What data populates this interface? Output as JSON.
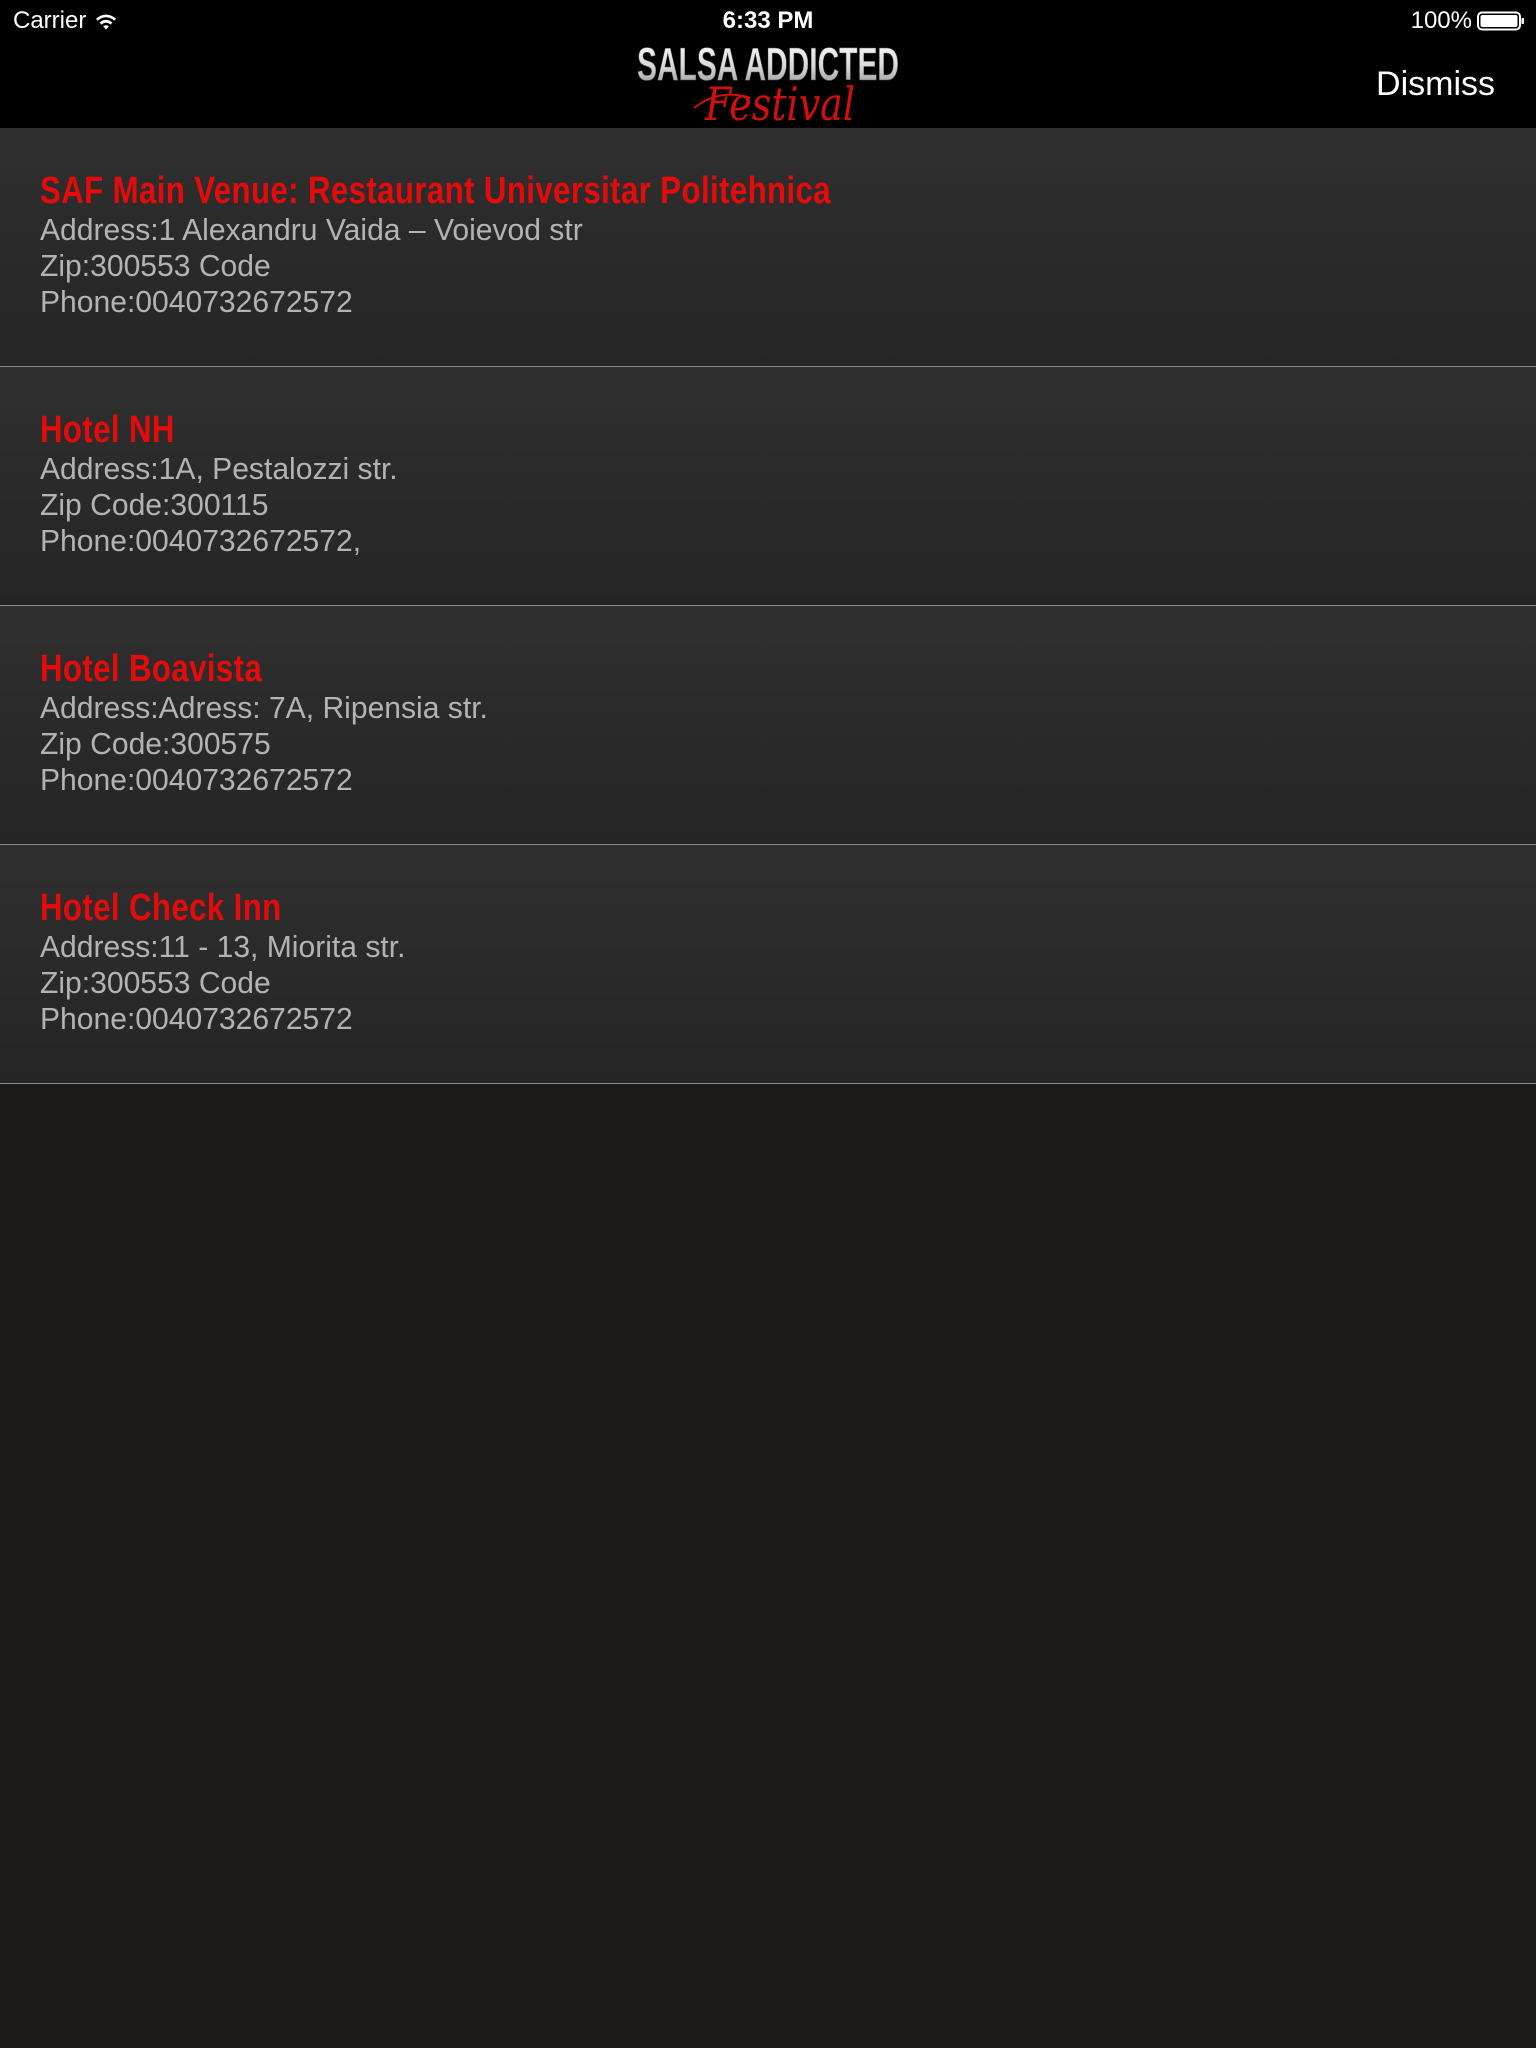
{
  "status_bar": {
    "carrier": "Carrier",
    "time": "6:33 PM",
    "battery": "100%"
  },
  "header": {
    "logo": {
      "line1": "SALSA ADDICTED",
      "line2": "Festival"
    },
    "dismiss_label": "Dismiss"
  },
  "venues": [
    {
      "name": "SAF Main Venue: Restaurant Universitar Politehnica",
      "address": "Address:1 Alexandru Vaida – Voievod str",
      "zip": "Zip:300553 Code",
      "phone": "Phone:0040732672572"
    },
    {
      "name": "Hotel NH",
      "address": "Address:1A, Pestalozzi str.",
      "zip": "Zip Code:300115",
      "phone": "Phone:0040732672572,"
    },
    {
      "name": "Hotel Boavista",
      "address": "Address:Adress: 7A, Ripensia str.",
      "zip": "Zip Code:300575",
      "phone": "Phone:0040732672572"
    },
    {
      "name": "Hotel Check Inn",
      "address": "Address:11 - 13, Miorita str.",
      "zip": "Zip:300553 Code",
      "phone": "Phone:0040732672572"
    }
  ],
  "colors": {
    "accent": "#e50b0b",
    "background": "#1c1b1a",
    "cell_text": "#b3b3b3"
  }
}
